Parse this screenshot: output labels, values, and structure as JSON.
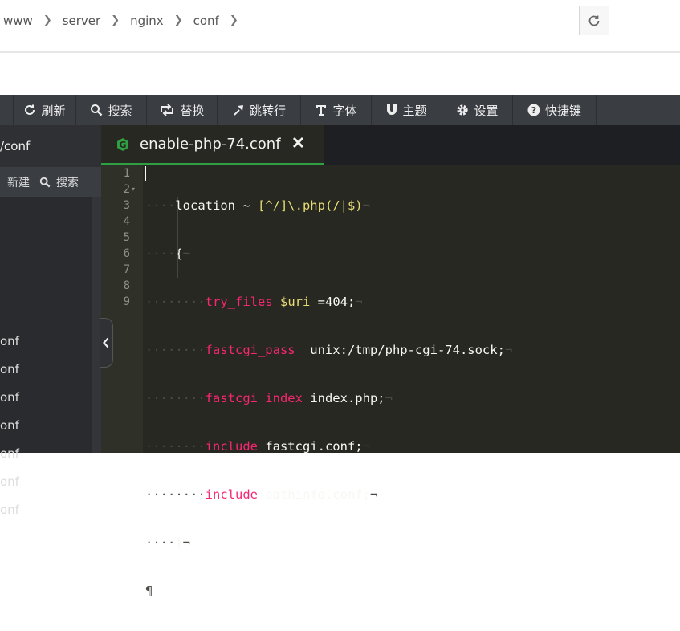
{
  "breadcrumb": [
    "www",
    "server",
    "nginx",
    "conf"
  ],
  "toolbar": {
    "items": [
      {
        "icon": "refresh-icon",
        "label": "刷新",
        "width": 78
      },
      {
        "icon": "search-icon",
        "label": "搜索",
        "width": 88
      },
      {
        "icon": "replace-icon",
        "label": "替换",
        "width": 88
      },
      {
        "icon": "goto-line-icon",
        "label": "跳转行",
        "width": 104
      },
      {
        "icon": "font-icon",
        "label": "字体",
        "width": 88
      },
      {
        "icon": "theme-icon",
        "label": "主题",
        "width": 88
      },
      {
        "icon": "settings-icon",
        "label": "设置",
        "width": 88
      },
      {
        "icon": "help-icon",
        "label": "快捷键",
        "width": 104
      }
    ]
  },
  "sidebar": {
    "path": "/conf",
    "new_label": "新建",
    "search_label": "搜索",
    "files": [
      "onf",
      "onf",
      "onf",
      "onf",
      "onf",
      "onf",
      "onf"
    ]
  },
  "editor": {
    "tab_title": "enable-php-74.conf",
    "line_numbers": [
      "1",
      "2",
      "3",
      "4",
      "5",
      "6",
      "7",
      "8",
      "9"
    ],
    "lines": [
      "location ~ [^/]\\.php(/|$)",
      "{",
      "try_files $uri =404;",
      "fastcgi_pass  unix:/tmp/php-cgi-74.sock;",
      "fastcgi_index index.php;",
      "include fastcgi.conf;",
      "include pathinfo.conf;",
      "}",
      ""
    ]
  },
  "colors": {
    "toolbar_bg": "#3a3d42",
    "editor_bg": "#272822",
    "keyword": "#f92672",
    "string": "#e6db74",
    "tab_accent": "#2ea043"
  }
}
